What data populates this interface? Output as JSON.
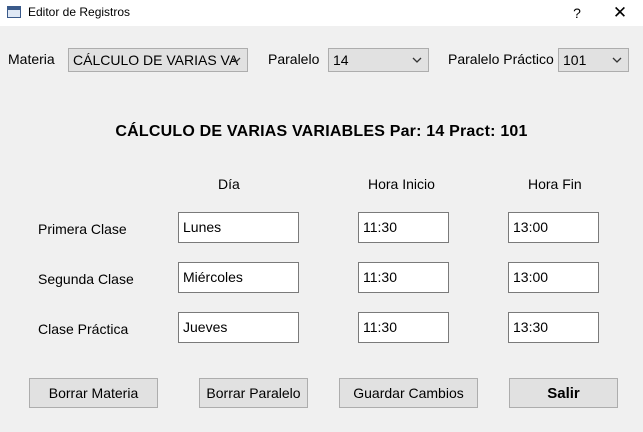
{
  "window": {
    "title": "Editor de Registros",
    "help_label": "?",
    "close_label": "✕"
  },
  "selectors": {
    "materia_label": "Materia",
    "materia_value": "CÁLCULO DE VARIAS VA",
    "paralelo_label": "Paralelo",
    "paralelo_value": "14",
    "paralelo_practico_label": "Paralelo Práctico",
    "paralelo_practico_value": "101"
  },
  "heading": "CÁLCULO DE VARIAS VARIABLES Par: 14 Pract: 101",
  "schedule": {
    "headers": {
      "dia": "Día",
      "hora_inicio": "Hora Inicio",
      "hora_fin": "Hora Fin"
    },
    "rows": [
      {
        "label": "Primera Clase",
        "dia": "Lunes",
        "inicio": "11:30",
        "fin": "13:00"
      },
      {
        "label": "Segunda Clase",
        "dia": "Miércoles",
        "inicio": "11:30",
        "fin": "13:00"
      },
      {
        "label": "Clase Práctica",
        "dia": "Jueves",
        "inicio": "11:30",
        "fin": "13:30"
      }
    ]
  },
  "buttons": {
    "borrar_materia": "Borrar Materia",
    "borrar_paralelo": "Borrar Paralelo",
    "guardar_cambios": "Guardar Cambios",
    "salir": "Salir"
  },
  "icons": {
    "app": "window-app-icon",
    "combo_arrow": "chevron-down-icon"
  }
}
